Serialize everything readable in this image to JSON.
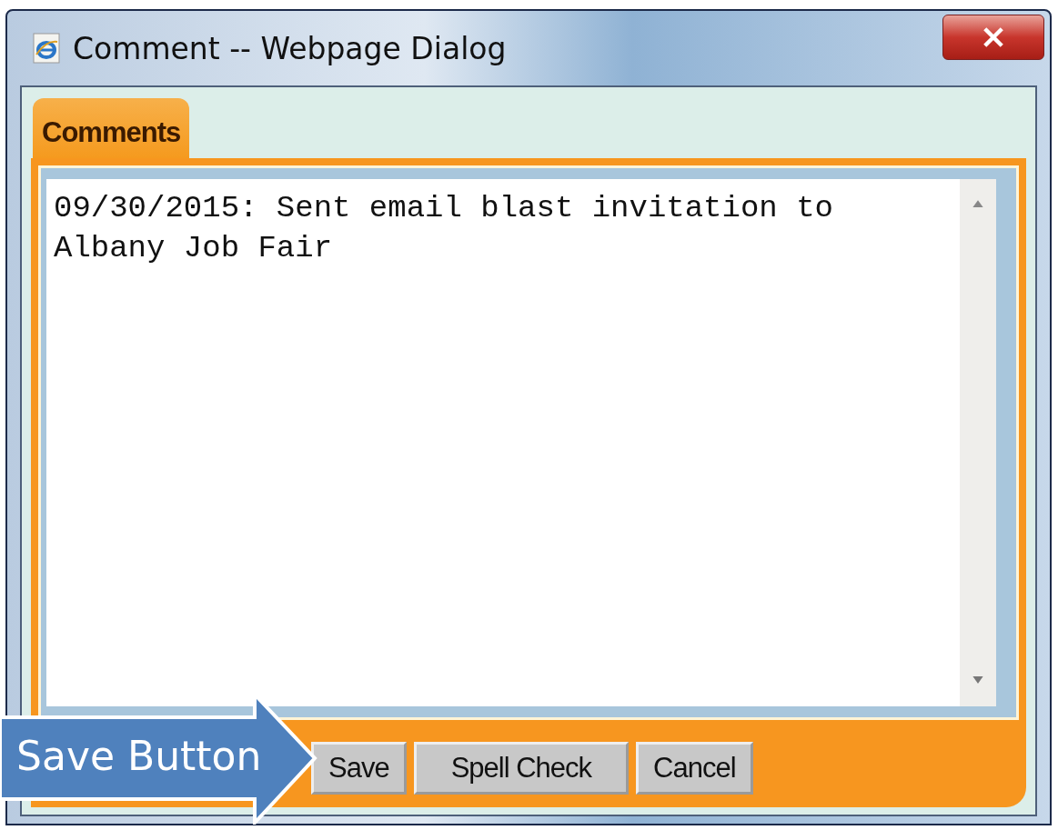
{
  "window": {
    "title": "Comment -- Webpage Dialog"
  },
  "tabs": [
    {
      "label": "Comments",
      "selected": true
    }
  ],
  "comment": {
    "value": "09/30/2015: Sent email blast invitation to Albany Job Fair"
  },
  "buttons": [
    {
      "label": "Save"
    },
    {
      "label": "Spell Check"
    },
    {
      "label": "Cancel"
    }
  ],
  "callout": {
    "label": "Save Button"
  }
}
